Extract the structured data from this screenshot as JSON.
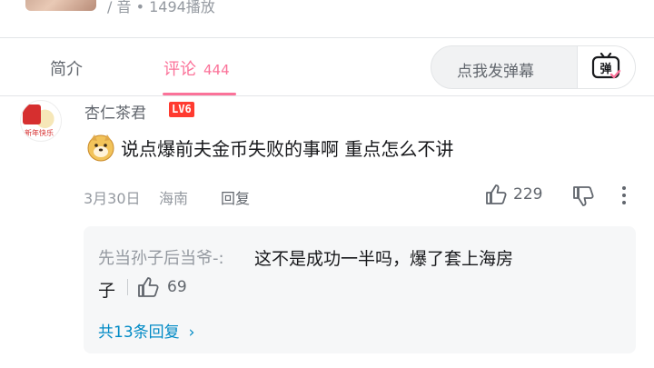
{
  "video": {
    "meta": "/ 音 • 1494播放"
  },
  "tabs": {
    "intro": "简介",
    "comments": "评论",
    "comments_count": "444"
  },
  "danmaku": {
    "placeholder": "点我发弹幕",
    "button_label": "弹"
  },
  "comment": {
    "username": "杏仁茶君",
    "level": "LV6",
    "text": "说点爆前夫金币失败的事啊 重点怎么不讲",
    "date": "3月30日",
    "location": "海南",
    "reply_label": "回复",
    "likes": "229",
    "avatar_text": "新年快乐"
  },
  "sub_reply": {
    "username": "先当孙子后当爷-:",
    "text_line1": "这不是成功一半吗，爆了套上海房",
    "text_line2": "子",
    "likes": "69",
    "view_more": "共13条回复",
    "view_more_chevron": "›"
  },
  "colors": {
    "accent": "#fb7299",
    "link": "#008ac5",
    "level_badge": "#ff3b30"
  }
}
